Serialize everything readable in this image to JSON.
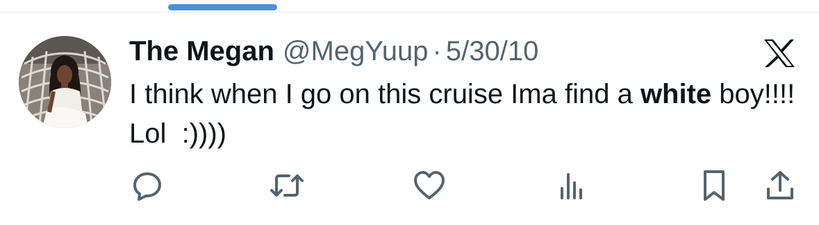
{
  "tweet": {
    "display_name": "The Megan",
    "handle": "@MegYuup",
    "separator": "·",
    "date": "5/30/10",
    "text_before_bold": "I think when I go on this cruise Ima find a ",
    "text_bold": "white",
    "text_after_bold": " boy!!!! Lol  :))))"
  },
  "icons": {
    "brand": "x-logo-icon",
    "actions": [
      "reply-icon",
      "retweet-icon",
      "like-icon",
      "views-icon",
      "bookmark-icon",
      "share-icon"
    ]
  },
  "colors": {
    "text_primary": "#0f1419",
    "text_secondary": "#536471",
    "tab_indicator": "#4a90e2",
    "divider": "#e6e9ec"
  }
}
